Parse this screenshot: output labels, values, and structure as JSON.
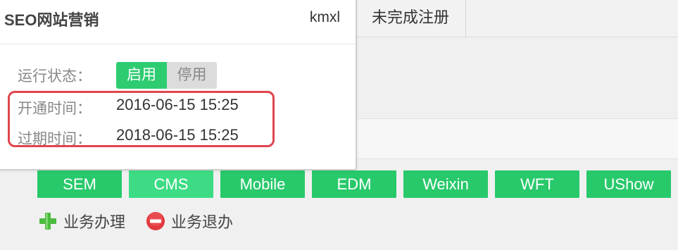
{
  "tabs": {
    "unregistered_label": "未完成注册"
  },
  "popup": {
    "title": "SEO网站营销",
    "user": "kmxl",
    "status_label": "运行状态：",
    "toggle": {
      "on_label": "启用",
      "off_label": "停用",
      "selected": "启用"
    },
    "open_label": "开通时间：",
    "open_value": "2016-06-15 15:25",
    "expire_label": "过期时间：",
    "expire_value": "2018-06-15 15:25"
  },
  "services": [
    "SEM",
    "CMS",
    "Mobile",
    "EDM",
    "Weixin",
    "WFT",
    "UShow"
  ],
  "actions": {
    "apply_label": "业务办理",
    "cancel_label": "业务退办"
  },
  "colors": {
    "accent_green": "#28c96b",
    "highlight_red": "#e0454d",
    "add_icon_green": "#4cbb3f",
    "remove_icon_red": "#e2383d"
  },
  "icons": {
    "apply": "plus-icon",
    "cancel": "minus-circle-icon"
  }
}
